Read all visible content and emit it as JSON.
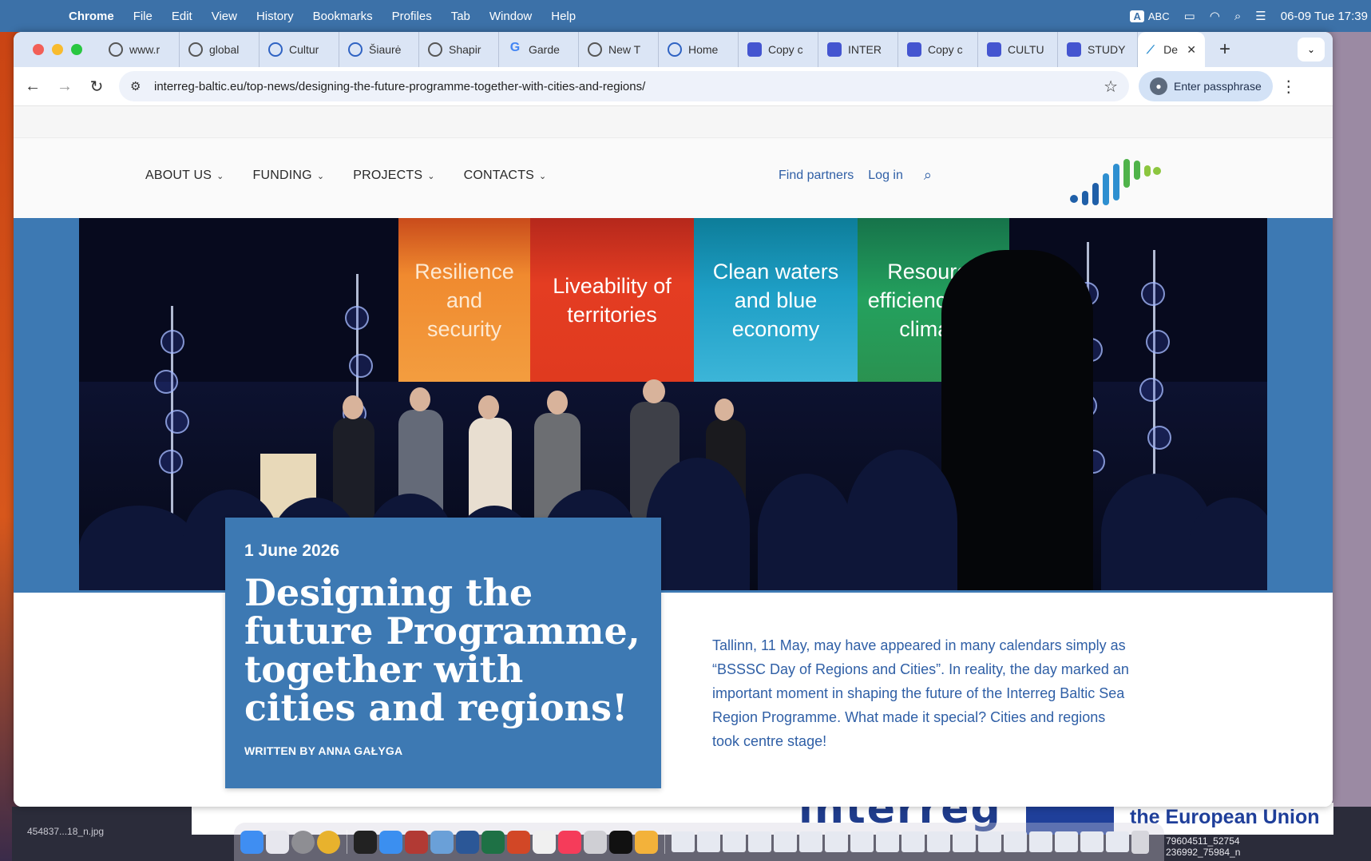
{
  "menubar": {
    "app": "Chrome",
    "items": [
      "File",
      "Edit",
      "View",
      "History",
      "Bookmarks",
      "Profiles",
      "Tab",
      "Window",
      "Help"
    ],
    "input_badge": "A",
    "input_label": "ABC",
    "datetime": "06-09 Tue  17:39"
  },
  "tabs": [
    {
      "label": "www.r",
      "icon": "globe-icon"
    },
    {
      "label": "global",
      "icon": "globe-icon"
    },
    {
      "label": "Cultur",
      "icon": "globe-icon"
    },
    {
      "label": "Šiaurė",
      "icon": "globe-icon"
    },
    {
      "label": "Shapir",
      "icon": "globe-icon"
    },
    {
      "label": "Garde",
      "icon": "google-icon"
    },
    {
      "label": "New T",
      "icon": "chrome-icon"
    },
    {
      "label": "Home",
      "icon": "site-icon"
    },
    {
      "label": "Copy c",
      "icon": "chat-icon"
    },
    {
      "label": "INTER",
      "icon": "chat-icon"
    },
    {
      "label": "Copy c",
      "icon": "chat-icon"
    },
    {
      "label": "CULTU",
      "icon": "chat-icon"
    },
    {
      "label": "STUDY",
      "icon": "chat-icon"
    }
  ],
  "active_tab": {
    "label": "De",
    "icon": "interreg-icon"
  },
  "toolbar": {
    "url": "interreg-baltic.eu/top-news/designing-the-future-programme-together-with-cities-and-regions/",
    "passphrase_label": "Enter passphrase"
  },
  "site": {
    "nav": [
      "ABOUT US",
      "FUNDING",
      "PROJECTS",
      "CONTACTS"
    ],
    "find_partners": "Find partners",
    "login": "Log in",
    "logo_colors": [
      "#1f5fa8",
      "#2e8fd0",
      "#4fb34a",
      "#8cc63f"
    ]
  },
  "hero": {
    "panels": [
      "Resilience and security",
      "Liveability of territories",
      "Clean waters and blue economy",
      "Resource efficiency and climate"
    ]
  },
  "article": {
    "date": "1 June 2026",
    "title": "Designing the future Programme, together with cities and regions!",
    "author": "WRITTEN BY ANNA GAŁYGA",
    "lead": "Tallinn, 11 May, may have appeared in many calendars simply as “BSSSC Day of Regions and Cities”. In reality, the day marked an important moment in shaping the future of the Interreg Baltic Sea Region Programme. What made it special? Cities and regions took centre stage!"
  },
  "desktop": {
    "background_banner_text": "interreg",
    "background_banner_eu": "the European Union",
    "file_label": "454837...18_n.jpg",
    "file_label_2": "79604511_52754\n236992_75984_n"
  }
}
